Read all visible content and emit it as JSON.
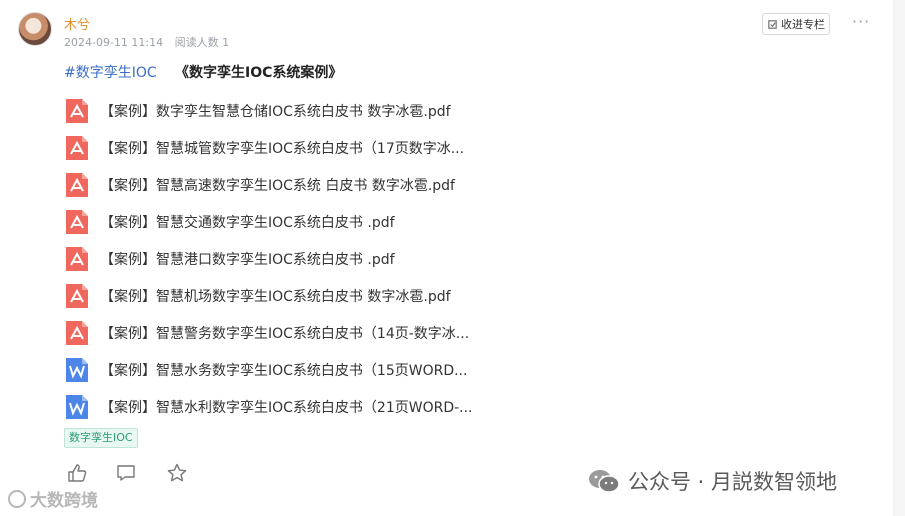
{
  "post": {
    "author": "木兮",
    "timestamp": "2024-09-11 11:14",
    "read_count": "阅读人数 1",
    "collect_label": "收进专栏",
    "more_label": "···"
  },
  "header": {
    "hashtag": "#数字孪生IOC",
    "collection_title": "《数字孪生IOC系统案例》"
  },
  "files": [
    {
      "name": "【案例】数字孪生智慧仓储IOC系统白皮书 数字冰雹.pdf",
      "type": "pdf-icon"
    },
    {
      "name": "【案例】智慧城管数字孪生IOC系统白皮书（17页数字冰...",
      "type": "pdf-icon"
    },
    {
      "name": "【案例】智慧高速数字孪生IOC系统 白皮书 数字冰雹.pdf",
      "type": "pdf-icon"
    },
    {
      "name": "【案例】智慧交通数字孪生IOC系统白皮书 .pdf",
      "type": "pdf-icon"
    },
    {
      "name": "【案例】智慧港口数字孪生IOC系统白皮书 .pdf",
      "type": "pdf-icon"
    },
    {
      "name": "【案例】智慧机场数字孪生IOC系统白皮书 数字冰雹.pdf",
      "type": "pdf-icon"
    },
    {
      "name": "【案例】智慧警务数字孪生IOC系统白皮书（14页-数字冰...",
      "type": "pdf-icon"
    },
    {
      "name": "【案例】智慧水务数字孪生IOC系统白皮书（15页WORD...",
      "type": "word-icon"
    },
    {
      "name": "【案例】智慧水利数字孪生IOC系统白皮书（21页WORD-...",
      "type": "word-icon"
    }
  ],
  "tag": "数字孪生IOC",
  "actions": [
    "like-icon",
    "comment-icon",
    "star-icon"
  ],
  "watermarks": {
    "left": "大数跨境",
    "right": "公众号 · 月説数智领地"
  },
  "colors": {
    "author": "#e08e2b",
    "hashtag": "#3b6dc7",
    "pdf": "#f0675e",
    "word": "#4b86e8",
    "tag_text": "#2a9d76",
    "tag_bg": "#e9f7f2"
  }
}
